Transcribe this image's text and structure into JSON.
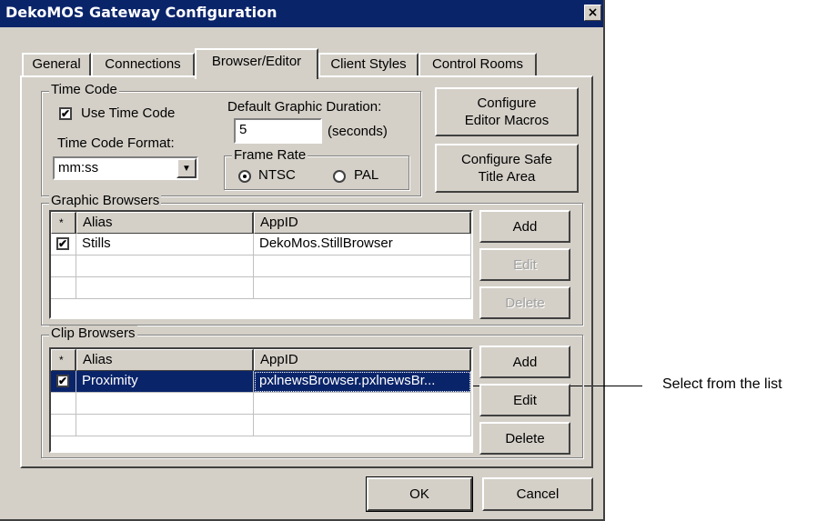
{
  "window": {
    "title": "DekoMOS Gateway Configuration",
    "close_symbol": "×"
  },
  "tabs": [
    {
      "label": "General"
    },
    {
      "label": "Connections"
    },
    {
      "label": "Browser/Editor"
    },
    {
      "label": "Client Styles"
    },
    {
      "label": "Control Rooms"
    }
  ],
  "active_tab": "Browser/Editor",
  "time_code": {
    "group_label": "Time Code",
    "use_time_code_label": "Use Time Code",
    "use_time_code_checked": true,
    "format_label": "Time Code Format:",
    "format_value": "mm:ss",
    "default_duration_label": "Default Graphic Duration:",
    "default_duration_value": "5",
    "seconds_label": "(seconds)",
    "frame_rate_label": "Frame Rate",
    "ntsc_label": "NTSC",
    "pal_label": "PAL",
    "frame_rate_selected": "NTSC"
  },
  "side_buttons": {
    "configure_macros": "Configure\nEditor Macros",
    "configure_safe_title": "Configure Safe\nTitle Area"
  },
  "graphic_browsers": {
    "group_label": "Graphic Browsers",
    "columns": [
      "*",
      "Alias",
      "AppID"
    ],
    "rows": [
      {
        "checked": true,
        "alias": "Stills",
        "appid": "DekoMos.StillBrowser"
      }
    ],
    "add_label": "Add",
    "edit_label": "Edit",
    "delete_label": "Delete"
  },
  "clip_browsers": {
    "group_label": "Clip Browsers",
    "columns": [
      "*",
      "Alias",
      "AppID"
    ],
    "rows": [
      {
        "checked": true,
        "alias": "Proximity",
        "appid": "pxlnewsBrowser.pxlnewsBr...",
        "selected": true
      }
    ],
    "add_label": "Add",
    "edit_label": "Edit",
    "delete_label": "Delete"
  },
  "footer": {
    "ok_label": "OK",
    "cancel_label": "Cancel"
  },
  "annotation": {
    "text": "Select from the list"
  },
  "colors": {
    "titlebar": "#0a246a",
    "face": "#d4d0c8",
    "selection": "#0a246a"
  },
  "icons": {
    "checkbox_check": "✔",
    "dropdown_arrow": "▼"
  }
}
